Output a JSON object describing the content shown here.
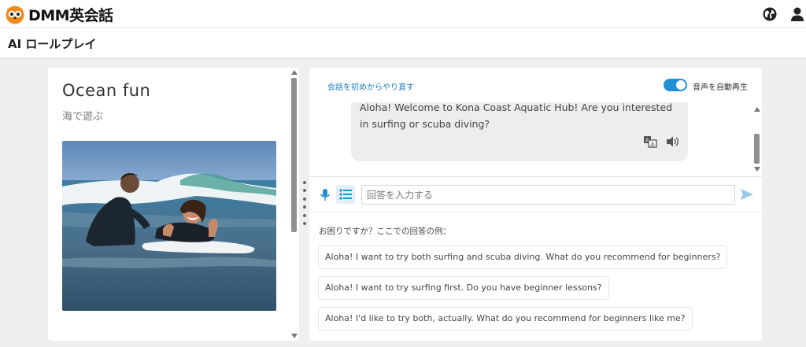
{
  "header": {
    "logo_text": "DMM英会話",
    "icons": {
      "globe": "globe-icon",
      "user": "user-icon"
    }
  },
  "subheader": {
    "title": "AI ロールプレイ"
  },
  "lesson": {
    "title": "Ocean fun",
    "subtitle": "海で遊ぶ",
    "image": "surfing-lesson-photo"
  },
  "chat": {
    "restart_label": "会話を初めからやり直す",
    "autoplay_label": "音声を自動再生",
    "autoplay_on": true,
    "messages": [
      {
        "role": "ai",
        "text": "Aloha! Welcome to Kona Coast Aquatic Hub! Are you interested in surfing or scuba diving?"
      }
    ],
    "input": {
      "placeholder": "回答を入力する",
      "value": ""
    },
    "help_title": "お困りですか？ここでの回答の例：",
    "suggestions": [
      "Aloha! I want to try both surfing and scuba diving. What do you recommend for beginners?",
      "Aloha! I want to try surfing first. Do you have beginner lessons?",
      "Aloha! I'd like to try both, actually. What do you recommend for beginners like me?"
    ]
  },
  "colors": {
    "accent": "#1f8fd6",
    "link": "#1b7fc0",
    "logo_orange": "#f08a1c",
    "background": "#efefef",
    "bubble": "#ededed"
  }
}
